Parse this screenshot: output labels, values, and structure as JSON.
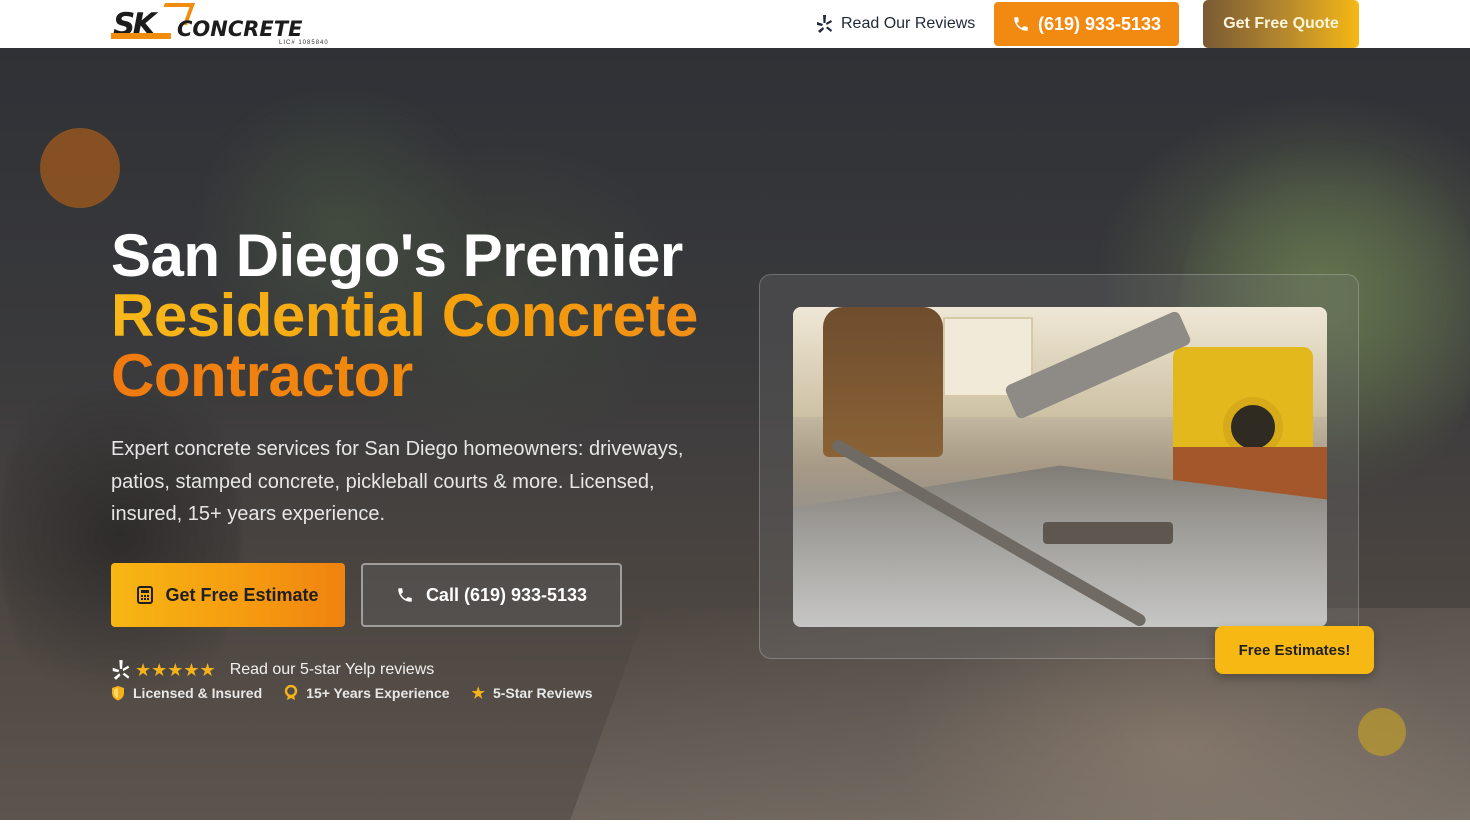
{
  "header": {
    "logo": {
      "mark": "SK",
      "wordmark": "CONCRETE",
      "license": "LIC# 1085840"
    },
    "reviews_link": "Read Our Reviews",
    "phone_button": "(619) 933-5133",
    "quote_button": "Get Free Quote"
  },
  "hero": {
    "headline_line1": "San Diego's Premier",
    "headline_line2": "Residential Concrete",
    "headline_line3": "Contractor",
    "subtext": "Expert concrete services for San Diego homeowners: driveways, patios, stamped concrete, pickleball courts & more. Licensed, insured, 15+ years experience.",
    "primary_cta": "Get Free Estimate",
    "secondary_cta": "Call (619) 933-5133",
    "yelp": {
      "stars": "★★★★★",
      "rating": 5,
      "label": "Read our 5-star Yelp reviews"
    },
    "badges": [
      {
        "icon": "shield-icon",
        "label": "Licensed & Insured"
      },
      {
        "icon": "award-icon",
        "label": "15+ Years Experience"
      },
      {
        "icon": "star-icon",
        "label": "5-Star Reviews"
      }
    ],
    "image_tag": "Free Estimates!"
  },
  "colors": {
    "accent_orange": "#f28a12",
    "accent_yellow": "#f7b813",
    "text_light": "#ffffff",
    "star": "#f5b21a"
  }
}
